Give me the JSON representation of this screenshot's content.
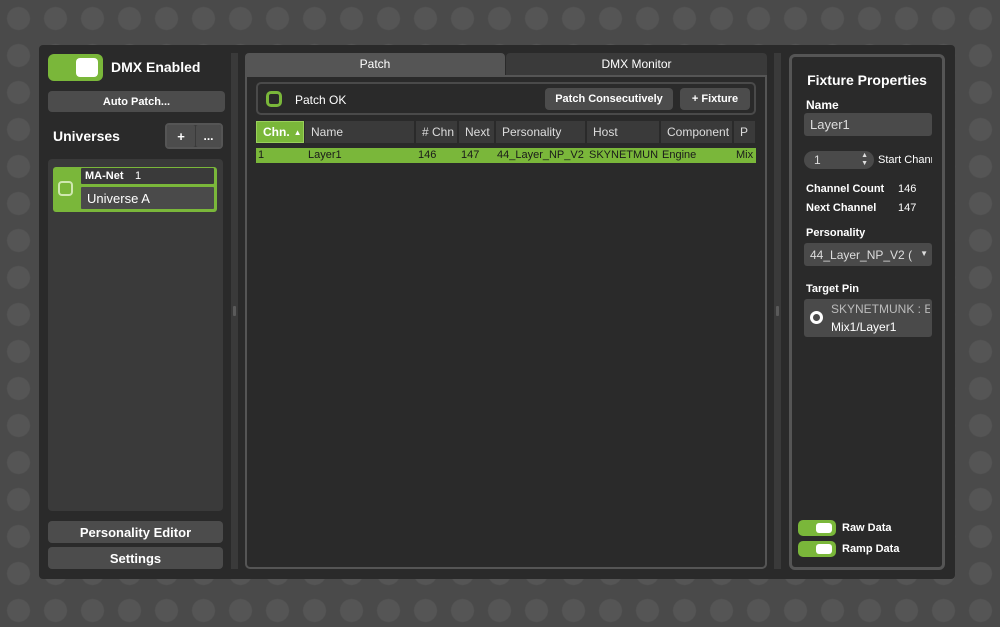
{
  "left": {
    "dmx_enabled_label": "DMX Enabled",
    "auto_patch_label": "Auto Patch...",
    "universes_title": "Universes",
    "add_label": "+",
    "more_label": "...",
    "universe": {
      "protocol": "MA-Net",
      "number": "1",
      "name": "Universe A"
    },
    "personality_editor_label": "Personality Editor",
    "settings_label": "Settings"
  },
  "center": {
    "tabs": [
      {
        "label": "Patch",
        "active": true
      },
      {
        "label": "DMX Monitor",
        "active": false
      }
    ],
    "patch_ok_label": "Patch OK",
    "patch_consecutively_label": "Patch Consecutively",
    "add_fixture_label": "+ Fixture",
    "columns": [
      "Chn.",
      "Name",
      "# Chn",
      "Next",
      "Personality",
      "Host",
      "Component",
      "P"
    ],
    "sort_indicator": "▲",
    "rows": [
      {
        "chn": "1",
        "name": "Layer1",
        "num_chn": "146",
        "next": "147",
        "personality": "44_Layer_NP_V2",
        "host": "SKYNETMUNI",
        "component": "Engine",
        "p": "Mix"
      }
    ]
  },
  "right": {
    "title": "Fixture Properties",
    "name_label": "Name",
    "name_value": "Layer1",
    "start_channel_value": "1",
    "start_channel_label": "Start Chann",
    "channel_count_label": "Channel Count",
    "channel_count_value": "146",
    "next_channel_label": "Next Channel",
    "next_channel_value": "147",
    "personality_label": "Personality",
    "personality_value": "44_Layer_NP_V2 (",
    "target_pin_label": "Target Pin",
    "target_pin_host": "SKYNETMUNK : E",
    "target_pin_path": "Mix1/Layer1",
    "raw_data_label": "Raw Data",
    "ramp_data_label": "Ramp Data"
  },
  "colors": {
    "accent": "#7ab73a",
    "panel": "#2a2a2a",
    "button": "#4c4c4c"
  }
}
